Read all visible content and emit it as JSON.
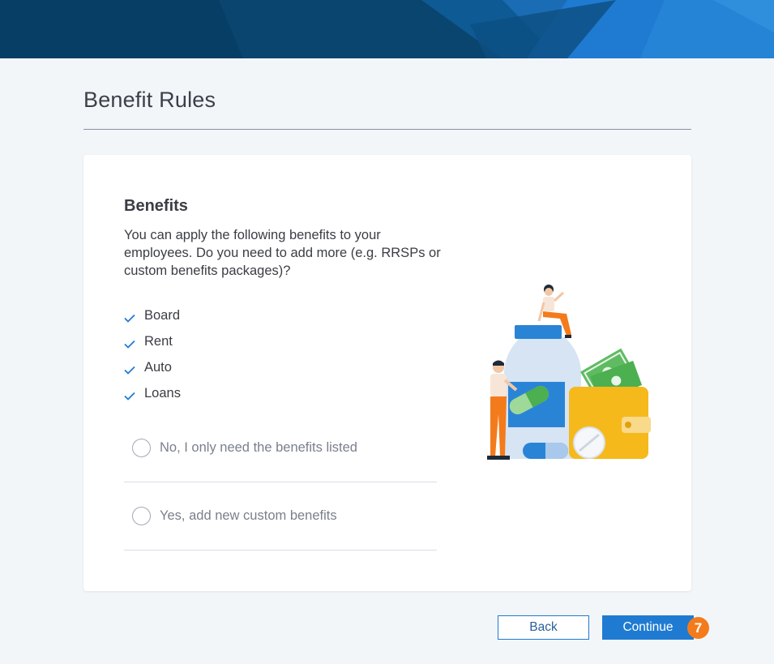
{
  "page": {
    "title": "Benefit Rules"
  },
  "card": {
    "heading": "Benefits",
    "description": "You can apply the following benefits to your employees. Do you need to add more (e.g. RRSPs or custom benefits packages)?",
    "benefits": [
      "Board",
      "Rent",
      "Auto",
      "Loans"
    ],
    "options": [
      {
        "label": "No, I only need the benefits listed",
        "selected": false
      },
      {
        "label": "Yes, add new custom benefits",
        "selected": false
      }
    ]
  },
  "footer": {
    "back_label": "Back",
    "continue_label": "Continue",
    "step_badge": "7"
  },
  "colors": {
    "banner_dark": "#073e66",
    "banner_light": "#1f7bd1",
    "accent_blue": "#1f7bd1",
    "check_blue": "#1f7bd1",
    "badge_orange": "#f47b1b",
    "page_bg": "#f3f6f9"
  },
  "icons": {
    "check": "check-icon",
    "radio": "radio-circle-icon"
  }
}
